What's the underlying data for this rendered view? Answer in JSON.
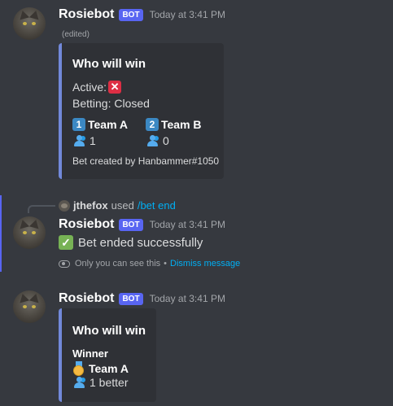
{
  "messages": [
    {
      "author": "Rosiebot",
      "bot_tag": "BOT",
      "timestamp": "Today at 3:41 PM",
      "edited": "(edited)",
      "embed": {
        "title": "Who will win",
        "active_label": "Active:",
        "active_icon": "cross-mark-icon",
        "betting": "Betting: Closed",
        "team_a_num": "1",
        "team_a": "Team A",
        "team_a_count": "1",
        "team_b_num": "2",
        "team_b": "Team B",
        "team_b_count": "0",
        "footer": "Bet created by Hanbammer#1050"
      }
    },
    {
      "reply_user": "jthefox",
      "reply_used": "used",
      "reply_command": "/bet end",
      "author": "Rosiebot",
      "bot_tag": "BOT",
      "timestamp": "Today at 3:41 PM",
      "content": "Bet ended successfully",
      "ephemeral_note": "Only you can see this",
      "dot": "•",
      "dismiss": "Dismiss message"
    },
    {
      "author": "Rosiebot",
      "bot_tag": "BOT",
      "timestamp": "Today at 3:41 PM",
      "embed": {
        "title": "Who will win",
        "winner_label": "Winner",
        "winner_team": "Team A",
        "betters": "1 better"
      }
    }
  ],
  "colors": {
    "background": "#36393f",
    "embed_bg": "#2f3136",
    "embed_accent": "#7289da",
    "bot_tag": "#5865f2",
    "link": "#00aff4"
  }
}
